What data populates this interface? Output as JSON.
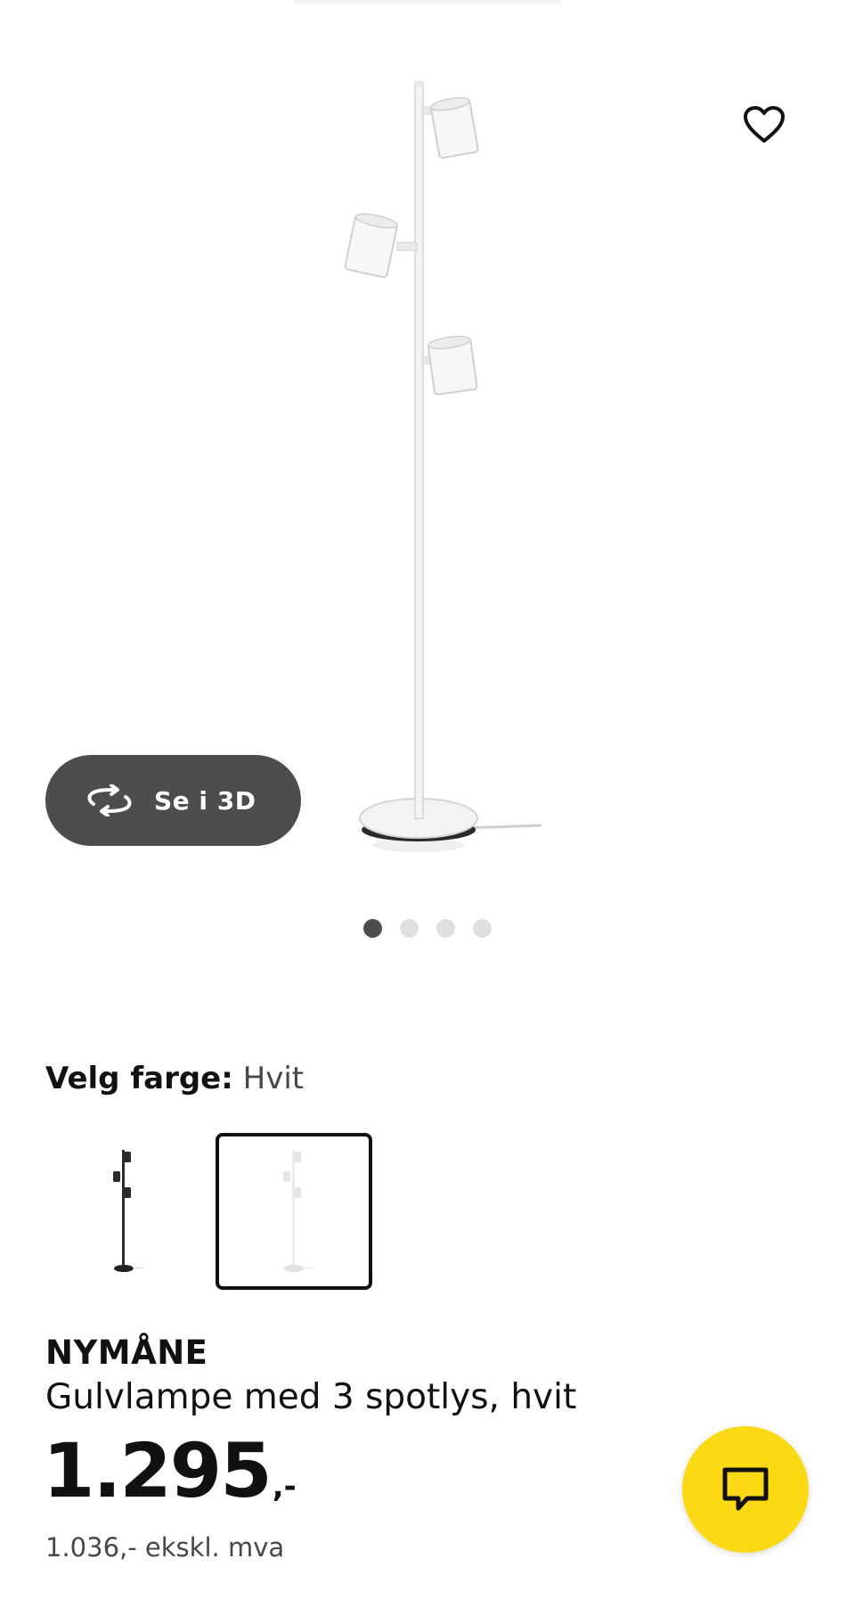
{
  "gallery": {
    "image_name": "Floor lamp with 3 spotlights, white",
    "favorite_icon": "heart-outline-icon",
    "view_3d": {
      "icon": "rotate-3d-icon",
      "label": "Se i 3D"
    },
    "dots_total": 4,
    "active_dot": 1
  },
  "color_picker": {
    "label": "Velg farge:",
    "selected_value": "Hvit",
    "options": [
      {
        "name": "black",
        "selected": false,
        "color": "#3a3a3a"
      },
      {
        "name": "white",
        "selected": true,
        "color": "#f2f2f2"
      }
    ]
  },
  "product": {
    "name": "NYMÅNE",
    "description": "Gulvlampe med 3 spotlys, hvit",
    "price": "1.295",
    "price_suffix": ",-",
    "price_ex_vat": "1.036,- ekskl. mva"
  },
  "chat": {
    "icon": "chat-bubble-icon",
    "color": "#fbd914"
  },
  "colors": {
    "dark_button": "#4d4d4d",
    "dot_active": "#4d4d4d",
    "dot_inactive": "#dfdfdf",
    "accent_yellow": "#fbd914"
  }
}
